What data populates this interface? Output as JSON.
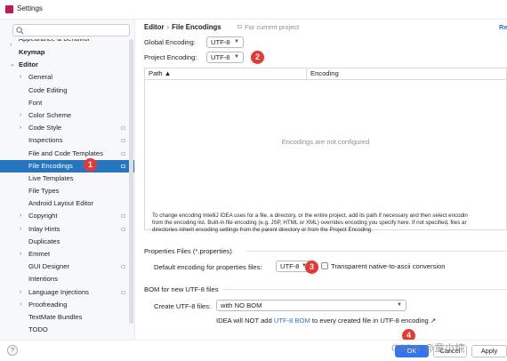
{
  "window": {
    "title": "Settings"
  },
  "sidebar": {
    "search_placeholder": "",
    "items": [
      {
        "label": "Appearance & Behavior",
        "level": 0,
        "arrow": "›",
        "clipped": true
      },
      {
        "label": "Keymap",
        "level": 0,
        "bold": true
      },
      {
        "label": "Editor",
        "level": 0,
        "arrow": "⌄",
        "bold": true
      },
      {
        "label": "General",
        "level": 1,
        "arrow": "›"
      },
      {
        "label": "Code Editing",
        "level": 1
      },
      {
        "label": "Font",
        "level": 1
      },
      {
        "label": "Color Scheme",
        "level": 1,
        "arrow": "›"
      },
      {
        "label": "Code Style",
        "level": 1,
        "arrow": "›",
        "proj": true
      },
      {
        "label": "Inspections",
        "level": 1,
        "proj": true
      },
      {
        "label": "File and Code Templates",
        "level": 1,
        "proj": true
      },
      {
        "label": "File Encodings",
        "level": 1,
        "proj": true,
        "selected": true
      },
      {
        "label": "Live Templates",
        "level": 1
      },
      {
        "label": "File Types",
        "level": 1
      },
      {
        "label": "Android Layout Editor",
        "level": 1
      },
      {
        "label": "Copyright",
        "level": 1,
        "arrow": "›",
        "proj": true
      },
      {
        "label": "Inlay Hints",
        "level": 1,
        "arrow": "›",
        "proj": true
      },
      {
        "label": "Duplicates",
        "level": 1
      },
      {
        "label": "Emmet",
        "level": 1,
        "arrow": "›"
      },
      {
        "label": "GUI Designer",
        "level": 1,
        "proj": true
      },
      {
        "label": "Intentions",
        "level": 1
      },
      {
        "label": "Language Injections",
        "level": 1,
        "arrow": "›",
        "proj": true
      },
      {
        "label": "Proofreading",
        "level": 1,
        "arrow": "›"
      },
      {
        "label": "TextMate Bundles",
        "level": 1
      },
      {
        "label": "TODO",
        "level": 1
      }
    ]
  },
  "header": {
    "breadcrumb_parent": "Editor",
    "breadcrumb_sep": "›",
    "breadcrumb_current": "File Encodings",
    "scope_label": "For current project",
    "reset_label": "Re"
  },
  "encodings": {
    "global_label": "Global Encoding:",
    "global_value": "UTF-8",
    "project_label": "Project Encoding:",
    "project_value": "UTF-8"
  },
  "table": {
    "columns": [
      "Path ▲",
      "Encoding"
    ],
    "empty_text": "Encodings are not configured"
  },
  "help_lines": [
    "To change encoding IntelliJ IDEA uses for a file, a directory, or the entire project, add its path if necessary and then select encodin",
    "from the encoding list. Built-in file encoding (e.g. JSP, HTML or XML) overrides encoding you specify here. If not specified, files ar",
    "directories inherit encoding settings from the parent directory or from the Project Encoding."
  ],
  "properties": {
    "section_title": "Properties Files (*.properties)",
    "default_label": "Default encoding for properties files:",
    "default_value": "UTF-8",
    "transparent_label": "Transparent native-to-ascii conversion",
    "transparent_checked": false
  },
  "bom": {
    "section_title": "BOM for new UTF-8 files",
    "create_label": "Create UTF-8 files:",
    "create_value": "with NO BOM",
    "note_prefix": "IDEA will NOT add",
    "note_link": "UTF-8 BOM",
    "note_suffix": "to every created file in UTF-8 encoding ↗"
  },
  "badges": [
    "1",
    "2",
    "3",
    "4"
  ],
  "footer": {
    "help": "?",
    "ok": "OK",
    "cancel": "Cancel",
    "apply": "Apply"
  },
  "watermark": "CSDN @童小纯",
  "colors": {
    "selection": "#2675bf",
    "primary_button": "#3574f0",
    "link": "#2f71d8",
    "badge": "#e53935",
    "app_icon": "#c2185b"
  }
}
